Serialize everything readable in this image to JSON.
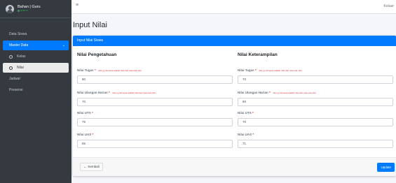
{
  "user": {
    "name": "Bahan | Guru",
    "status": "online"
  },
  "sidebar": {
    "items": [
      {
        "label": "Data Siswa"
      },
      {
        "label": "Master Data",
        "chevron": "⌄"
      },
      {
        "label": "Kelas"
      },
      {
        "label": "Nilai"
      },
      {
        "label": "Jadwal"
      },
      {
        "label": "Presensi"
      }
    ]
  },
  "topbar": {
    "menu_icon": "≡",
    "right_text": "Keluar"
  },
  "page": {
    "title": "Input Nilai"
  },
  "card": {
    "header": "Input Nilai Siswa",
    "left": {
      "title": "Nilai Pengetahuan",
      "fields": [
        {
          "label": "Nilai Tugas",
          "hint": "nilai yg dimasuk adalah nilai dari rata-rata nilai",
          "value": "80"
        },
        {
          "label": "Nilai Ulangan Harian",
          "hint": "nilai yg dimasuk adalah nilai dari rata-rata nilai",
          "value": "70"
        },
        {
          "label": "Nilai UTS",
          "hint": "",
          "value": "75"
        },
        {
          "label": "Nilai UAS",
          "hint": "",
          "value": "85"
        }
      ]
    },
    "right": {
      "title": "Nilai Keterampilan",
      "fields": [
        {
          "label": "Nilai Tugas",
          "hint": "nilai yg dimasuk adalah nilai dari rata-rata nilai",
          "value": "70"
        },
        {
          "label": "Nilai Ulangan Harian",
          "hint": "nilai yg dimasuk adalah nilai dari rata-rata nilai",
          "value": "80"
        },
        {
          "label": "Nilai UTS",
          "hint": "",
          "value": "70"
        },
        {
          "label": "Nilai UAS",
          "hint": "",
          "value": "71"
        }
      ]
    },
    "required_mark": "*",
    "back_label": "Kembali",
    "update_label": "Update"
  },
  "colors": {
    "primary": "#007bff",
    "sidebar": "#343a40",
    "danger": "#dc3545",
    "online": "#28a745"
  }
}
